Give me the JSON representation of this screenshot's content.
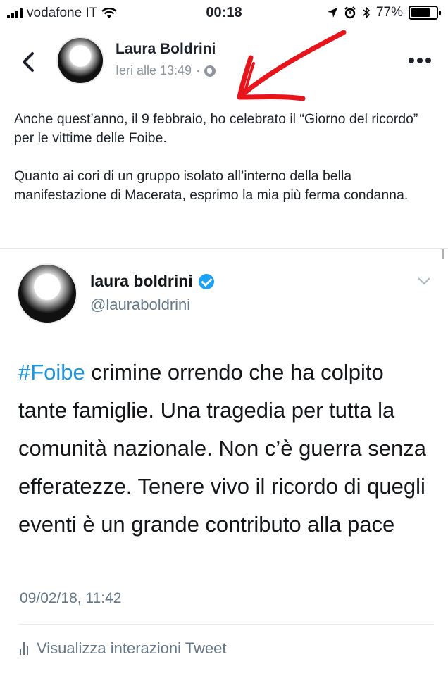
{
  "status_bar": {
    "carrier": "vodafone IT",
    "time": "00:18",
    "battery": "77%",
    "battery_level": 0.77
  },
  "post": {
    "author": "Laura Boldrini",
    "timestamp": "Ieri alle 13:49",
    "separator": "·",
    "paragraphs": [
      "Anche quest’anno, il 9 febbraio, ho celebrato il “Giorno del ricordo” per le vittime delle Foibe.",
      "Quanto ai cori di un gruppo isolato all’interno della bella manifestazione di Macerata, esprimo la mia più ferma condanna."
    ]
  },
  "tweet": {
    "name": "laura boldrini",
    "handle": "@lauraboldrini",
    "hashtag": "#Foibe",
    "text": " crimine orrendo che ha colpito tante famiglie. Una tragedia per tutta la comunità nazionale. Non c’è guerra senza efferatezze. Tenere vivo il ricordo di quegli eventi è un grande contributo alla pace",
    "date": "09/02/18, 11:42",
    "interactions_label": "Visualizza interazioni Tweet"
  },
  "colors": {
    "hashtag": "#1b95e0",
    "verified": "#1da1f2",
    "annotation_arrow": "#e8141c"
  }
}
